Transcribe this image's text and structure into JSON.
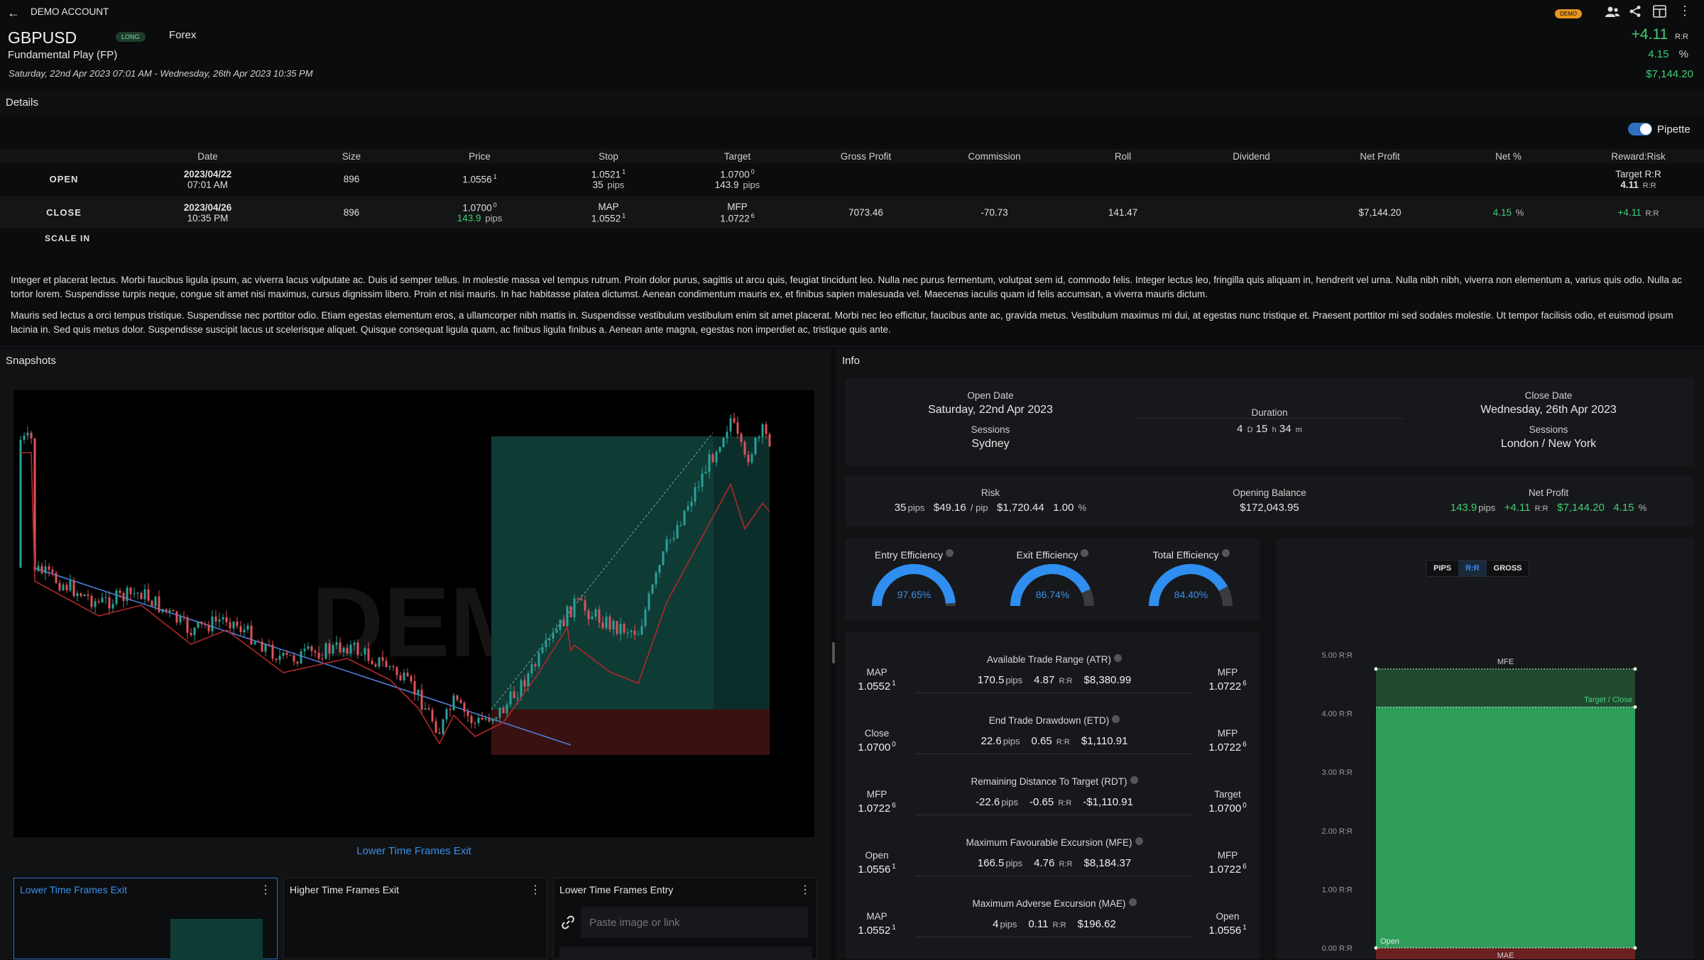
{
  "header": {
    "back_label": "DEMO ACCOUNT",
    "symbol": "GBPUSD",
    "direction_badge": "LONG",
    "asset_class": "Forex",
    "strategy": "Fundamental Play (FP)",
    "date_range": "Saturday, 22nd Apr 2023 07:01 AM - Wednesday, 26th Apr 2023 10:35 PM",
    "demo_badge": "DEMO",
    "rr_value": "+4.11",
    "rr_unit": "R:R",
    "pct_value": "4.15",
    "pct_unit": "%",
    "net_profit": "$7,144.20"
  },
  "details": {
    "title": "Details",
    "toggle_label": "Pipette",
    "columns": [
      "Date",
      "Size",
      "Price",
      "Stop",
      "Target",
      "Gross Profit",
      "Commission",
      "Roll",
      "Dividend",
      "Net Profit",
      "Net %",
      "Reward:Risk"
    ],
    "open": {
      "label": "OPEN",
      "date": "2023/04/22",
      "time": "07:01 AM",
      "size": "896",
      "price": "1.0556",
      "price_sup": "1",
      "stop": "1.0521",
      "stop_sup": "1",
      "stop_pips": "35",
      "target": "1.0700",
      "target_sup": "0",
      "target_pips": "143.9",
      "target_rr_label": "Target R:R",
      "target_rr": "4.11"
    },
    "close": {
      "label": "CLOSE",
      "date": "2023/04/26",
      "time": "10:35 PM",
      "size": "896",
      "price": "1.0700",
      "price_sup": "0",
      "price_pips": "143.9",
      "map_label": "MAP",
      "map": "1.0552",
      "map_sup": "1",
      "mfp_label": "MFP",
      "mfp": "1.0722",
      "mfp_sup": "6",
      "gross": "7073.46",
      "commission": "-70.73",
      "roll": "141.47",
      "net_profit": "$7,144.20",
      "net_pct": "4.15",
      "rr": "+4.11"
    },
    "scale_in_label": "SCALE IN",
    "pips_unit": "pips",
    "pct_unit": "%",
    "rr_unit": "R:R"
  },
  "notes": [
    "Integer et placerat lectus. Morbi faucibus ligula ipsum, ac viverra lacus vulputate ac. Duis id semper tellus. In molestie massa vel tempus rutrum. Proin dolor purus, sagittis ut arcu quis, feugiat tincidunt leo. Nulla nec purus fermentum, volutpat sem id, commodo felis. Integer lectus leo, fringilla quis aliquam in, hendrerit vel urna. Nulla nibh nibh, viverra non elementum a, varius quis odio. Nulla ac tortor lorem. Suspendisse turpis neque, congue sit amet nisi maximus, cursus dignissim libero. Proin et nisi mauris. In hac habitasse platea dictumst. Aenean condimentum mauris ex, et finibus sapien malesuada vel. Maecenas iaculis quam id felis accumsan, a viverra mauris dictum.",
    "Mauris sed lectus a orci tempus tristique. Suspendisse nec porttitor odio. Etiam egestas elementum eros, a ullamcorper nibh mattis in. Suspendisse vestibulum vestibulum enim sit amet placerat. Morbi nec leo efficitur, faucibus ante ac, gravida metus. Vestibulum maximus mi dui, at egestas nunc tristique et. Praesent porttitor mi sed sodales molestie. Ut tempor facilisis odio, et euismod ipsum lacinia in. Sed quis metus dolor. Suspendisse suscipit lacus ut scelerisque aliquet. Quisque consequat ligula quam, ac finibus ligula finibus a. Aenean ante magna, egestas non imperdiet ac, tristique quis ante."
  ],
  "snapshots": {
    "title": "Snapshots",
    "watermark": "DEMO",
    "main_caption": "Lower Time Frames Exit",
    "thumbs": [
      {
        "title": "Lower Time Frames Exit"
      },
      {
        "title": "Higher Time Frames Exit"
      },
      {
        "title": "Lower Time Frames Entry"
      }
    ],
    "paste_placeholder": "Paste image or link"
  },
  "info": {
    "title": "Info",
    "open_date_label": "Open Date",
    "open_date": "Saturday, 22nd Apr 2023",
    "open_sessions_label": "Sessions",
    "open_sessions": "Sydney",
    "duration_label": "Duration",
    "duration_d": "4",
    "duration_h": "15",
    "duration_m": "34",
    "d_unit": "D",
    "h_unit": "h",
    "m_unit": "m",
    "close_date_label": "Close Date",
    "close_date": "Wednesday, 26th Apr 2023",
    "close_sessions_label": "Sessions",
    "close_sessions": "London / New York",
    "risk_label": "Risk",
    "risk_pips": "35",
    "risk_per_pip": "$49.16",
    "per_pip_unit": "/ pip",
    "risk_amount": "$1,720.44",
    "risk_pct": "1.00",
    "opening_balance_label": "Opening Balance",
    "opening_balance": "$172,043.95",
    "net_profit_label": "Net Profit",
    "np_pips": "143.9",
    "np_rr": "+4.11",
    "np_amount": "$7,144.20",
    "np_pct": "4.15"
  },
  "efficiency": [
    {
      "label": "Entry Efficiency",
      "value": "97.65%",
      "fraction": 0.9765
    },
    {
      "label": "Exit Efficiency",
      "value": "86.74%",
      "fraction": 0.8674
    },
    {
      "label": "Total Efficiency",
      "value": "84.40%",
      "fraction": 0.844
    }
  ],
  "metrics": [
    {
      "left_label": "MAP",
      "left_val": "1.0552",
      "left_sup": "1",
      "title": "Available Trade Range (ATR)",
      "pips": "170.5",
      "rr": "4.87",
      "amount": "$8,380.99",
      "right_label": "MFP",
      "right_val": "1.0722",
      "right_sup": "6"
    },
    {
      "left_label": "Close",
      "left_val": "1.0700",
      "left_sup": "0",
      "title": "End Trade Drawdown (ETD)",
      "pips": "22.6",
      "rr": "0.65",
      "amount": "$1,110.91",
      "right_label": "MFP",
      "right_val": "1.0722",
      "right_sup": "6"
    },
    {
      "left_label": "MFP",
      "left_val": "1.0722",
      "left_sup": "6",
      "title": "Remaining Distance To Target (RDT)",
      "pips": "-22.6",
      "rr": "-0.65",
      "amount": "-$1,110.91",
      "right_label": "Target",
      "right_val": "1.0700",
      "right_sup": "0"
    },
    {
      "left_label": "Open",
      "left_val": "1.0556",
      "left_sup": "1",
      "title": "Maximum Favourable Excursion (MFE)",
      "pips": "166.5",
      "rr": "4.76",
      "amount": "$8,184.37",
      "right_label": "MFP",
      "right_val": "1.0722",
      "right_sup": "6"
    },
    {
      "left_label": "MAP",
      "left_val": "1.0552",
      "left_sup": "1",
      "title": "Maximum Adverse Excursion (MAE)",
      "pips": "4",
      "rr": "0.11",
      "amount": "$196.62",
      "right_label": "Open",
      "right_val": "1.0556",
      "right_sup": "1"
    }
  ],
  "excursion_chart": {
    "tabs": [
      "PIPS",
      "R:R",
      "GROSS"
    ],
    "active_tab": "R:R",
    "mfe_label": "MFE",
    "mae_label": "MAE",
    "open_label": "Open",
    "target_close_label": "Target / Close",
    "colors": {
      "mfe": "#1f4a30",
      "profit": "#2f9e5b",
      "mae": "#6b2020"
    }
  },
  "chart_data": {
    "type": "bar",
    "yticks": [
      "5.00 R:R",
      "4.00 R:R",
      "3.00 R:R",
      "2.00 R:R",
      "1.00 R:R",
      "0.00 R:R"
    ],
    "ylim": [
      0,
      5
    ],
    "mfe": 4.76,
    "target_close": 4.11,
    "mae": -0.11
  }
}
